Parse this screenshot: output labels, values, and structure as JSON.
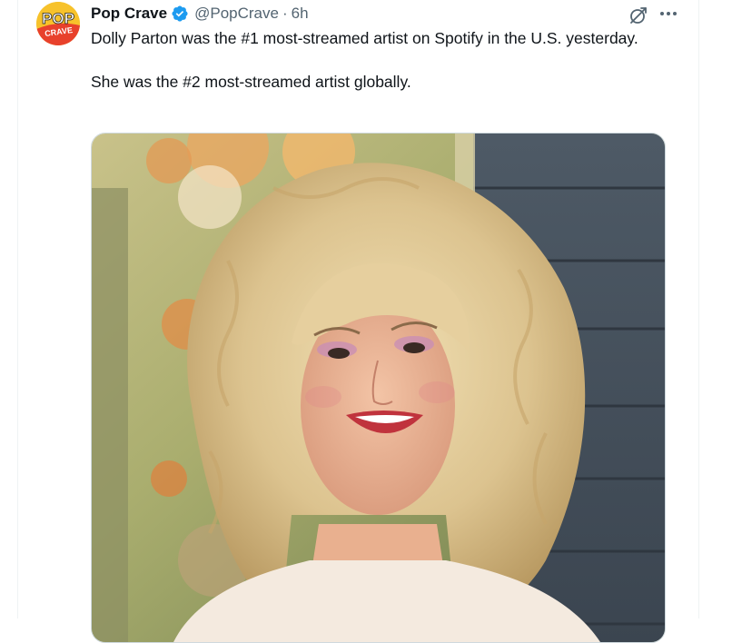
{
  "tweet": {
    "display_name": "Pop Crave",
    "handle": "@PopCrave",
    "separator": "·",
    "time": "6h",
    "text_line1": "Dolly Parton was the #1 most-streamed artist on Spotify in the U.S. yesterday.",
    "text_line2": "She was the #2 most-streamed artist globally.",
    "verified": true
  },
  "avatar": {
    "logo_top": "POP",
    "logo_bottom": "CRAVE",
    "bg_color": "#f7c22b",
    "accent_color": "#e8412c"
  },
  "icons": {
    "verified": "verified-badge-icon",
    "grok": "grok-icon",
    "more": "more-icon"
  },
  "colors": {
    "verified_blue": "#1d9bf0",
    "text": "#0f1419",
    "secondary_text": "#536471"
  }
}
